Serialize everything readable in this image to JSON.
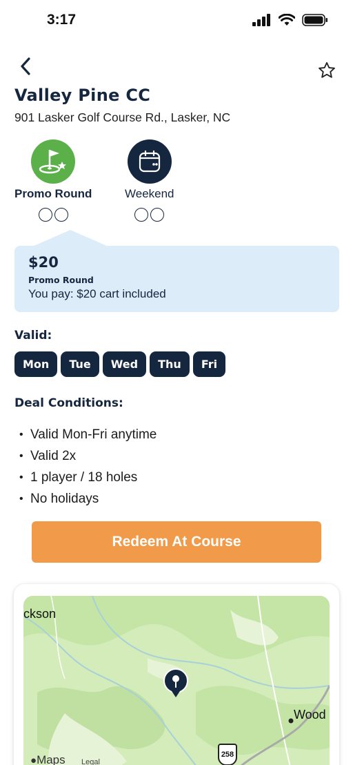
{
  "status": {
    "time": "3:17"
  },
  "course": {
    "name": "Valley Pine CC",
    "address": "901 Lasker Golf Course Rd., Lasker, NC"
  },
  "deal_tabs": [
    {
      "label": "Promo Round",
      "icon": "golf-flag-icon",
      "color": "#5cb04a",
      "selected": true
    },
    {
      "label": "Weekend",
      "icon": "calendar-icon",
      "color": "#15263f",
      "selected": false
    }
  ],
  "price_card": {
    "price": "$20",
    "type": "Promo Round",
    "you_pay": "You pay: $20 cart included"
  },
  "valid": {
    "label": "Valid:",
    "days": [
      "Mon",
      "Tue",
      "Wed",
      "Thu",
      "Fri"
    ]
  },
  "conditions": {
    "label": "Deal Conditions:",
    "items": [
      "Valid Mon-Fri anytime",
      "Valid 2x",
      "1 player / 18 holes",
      "No holidays"
    ]
  },
  "redeem_button": {
    "label": "Redeem At Course"
  },
  "map": {
    "label_left": "ckson",
    "label_right": "Wood",
    "route_shield": "258",
    "brand": "Maps",
    "legal": "Legal"
  },
  "colors": {
    "navy": "#15263f",
    "green": "#5cb04a",
    "orange": "#f19a4a",
    "card_blue": "#dcecf8"
  }
}
